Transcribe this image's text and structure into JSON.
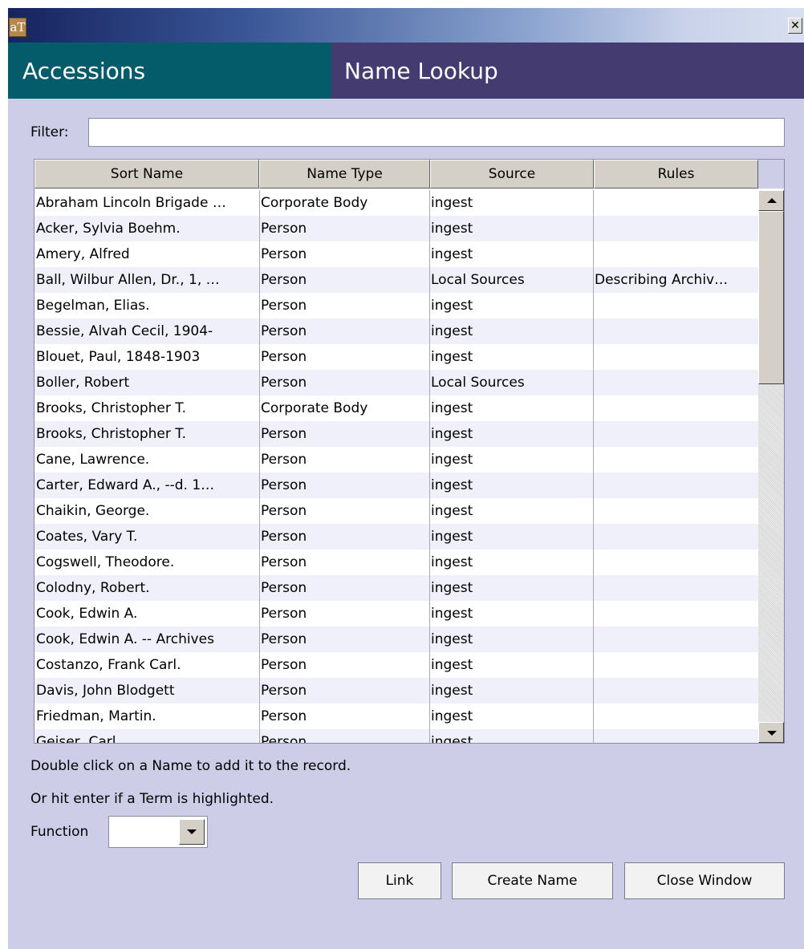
{
  "window": {
    "icon_label": "aT",
    "close_label": "✕"
  },
  "header": {
    "left_title": "Accessions",
    "right_title": "Name Lookup"
  },
  "filter": {
    "label": "Filter:",
    "value": ""
  },
  "table": {
    "columns": [
      "Sort Name",
      "Name Type",
      "Source",
      "Rules"
    ],
    "rows": [
      [
        "Abraham Lincoln Brigade …",
        "Corporate Body",
        "ingest",
        ""
      ],
      [
        "Acker, Sylvia Boehm.",
        "Person",
        "ingest",
        ""
      ],
      [
        "Amery, Alfred",
        "Person",
        "ingest",
        ""
      ],
      [
        "Ball, Wilbur Allen, Dr., 1, …",
        "Person",
        "Local Sources",
        "Describing Archiv…"
      ],
      [
        "Begelman, Elias.",
        "Person",
        "ingest",
        ""
      ],
      [
        "Bessie, Alvah Cecil, 1904-",
        "Person",
        "ingest",
        ""
      ],
      [
        "Blouet, Paul, 1848-1903",
        "Person",
        "ingest",
        ""
      ],
      [
        "Boller, Robert",
        "Person",
        "Local Sources",
        ""
      ],
      [
        "Brooks, Christopher T.",
        "Corporate Body",
        "ingest",
        ""
      ],
      [
        "Brooks, Christopher T.",
        "Person",
        "ingest",
        ""
      ],
      [
        "Cane, Lawrence.",
        "Person",
        "ingest",
        ""
      ],
      [
        "Carter, Edward A., --d. 1…",
        "Person",
        "ingest",
        ""
      ],
      [
        "Chaikin, George.",
        "Person",
        "ingest",
        ""
      ],
      [
        "Coates, Vary T.",
        "Person",
        "ingest",
        ""
      ],
      [
        "Cogswell, Theodore.",
        "Person",
        "ingest",
        ""
      ],
      [
        "Colodny, Robert.",
        "Person",
        "ingest",
        ""
      ],
      [
        "Cook, Edwin A.",
        "Person",
        "ingest",
        ""
      ],
      [
        "Cook, Edwin A. -- Archives",
        "Person",
        "ingest",
        ""
      ],
      [
        "Costanzo, Frank Carl.",
        "Person",
        "ingest",
        ""
      ],
      [
        "Davis, John Blodgett",
        "Person",
        "ingest",
        ""
      ],
      [
        "Friedman, Martin.",
        "Person",
        "ingest",
        ""
      ],
      [
        "Geiser, Carl",
        "Person",
        "ingest",
        ""
      ]
    ]
  },
  "hints": {
    "line1": "Double click on a Name to add it to the record.",
    "line2": "Or hit enter if a Term is highlighted."
  },
  "function": {
    "label": "Function",
    "selected": ""
  },
  "buttons": {
    "link": "Link",
    "create_name": "Create Name",
    "close_window": "Close Window"
  },
  "colors": {
    "window_bg": "#cdcde8",
    "header_left": "#045c6a",
    "header_right": "#443c70"
  }
}
